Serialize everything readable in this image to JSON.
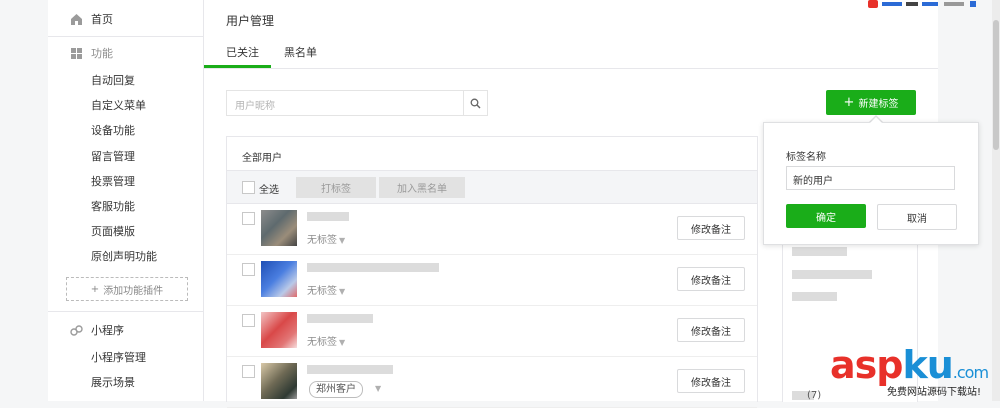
{
  "sidebar": {
    "home": "首页",
    "features_title": "功能",
    "features": [
      "自动回复",
      "自定义菜单",
      "设备功能",
      "留言管理",
      "投票管理",
      "客服功能",
      "页面模版",
      "原创声明功能"
    ],
    "add_plugin": "添加功能插件",
    "miniprogram_title": "小程序",
    "miniprogram_items": [
      "小程序管理",
      "展示场景"
    ]
  },
  "main": {
    "title": "用户管理",
    "tabs": [
      "已关注",
      "黑名单"
    ],
    "search_placeholder": "用户昵称",
    "new_tag_button": "新建标签",
    "table": {
      "header": "全部用户",
      "select_all": "全选",
      "tag_button": "打标签",
      "blacklist_button": "加入黑名单",
      "rows": [
        {
          "tag": "无标签",
          "remark": "修改备注"
        },
        {
          "tag": "无标签",
          "remark": "修改备注"
        },
        {
          "tag": "无标签",
          "remark": "修改备注"
        },
        {
          "tag": "郑州客户",
          "remark": "修改备注"
        }
      ]
    },
    "right_panel_count": "(7)"
  },
  "popover": {
    "label": "标签名称",
    "value": "新的用户",
    "ok": "确定",
    "cancel": "取消"
  },
  "watermark": {
    "a": "asp",
    "b": "ku",
    "c": ".com",
    "sub": "免费网站源码下载站!"
  },
  "colors": {
    "accent": "#1aad19",
    "watermark_red": "#e8312a",
    "watermark_blue": "#1a8fd6"
  }
}
